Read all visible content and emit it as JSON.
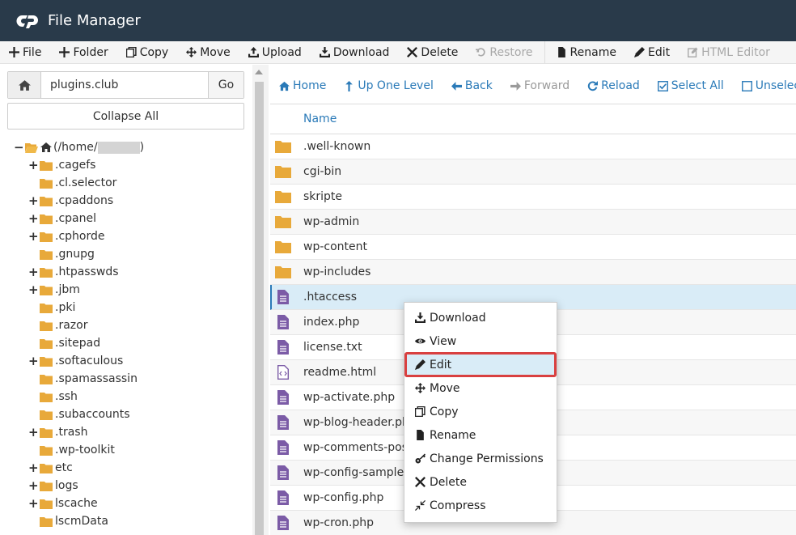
{
  "app": {
    "title": "File Manager"
  },
  "toolbar": {
    "file": "File",
    "folder": "Folder",
    "copy": "Copy",
    "move": "Move",
    "upload": "Upload",
    "download": "Download",
    "delete": "Delete",
    "restore": "Restore",
    "rename": "Rename",
    "edit": "Edit",
    "html_editor": "HTML Editor"
  },
  "path": {
    "value": "plugins.club",
    "go": "Go"
  },
  "collapse_all": "Collapse All",
  "tree": {
    "root_prefix": "(/home/",
    "root_suffix": ")",
    "items": [
      {
        "label": ".cagefs",
        "expandable": true
      },
      {
        "label": ".cl.selector",
        "expandable": false
      },
      {
        "label": ".cpaddons",
        "expandable": true
      },
      {
        "label": ".cpanel",
        "expandable": true
      },
      {
        "label": ".cphorde",
        "expandable": true
      },
      {
        "label": ".gnupg",
        "expandable": false
      },
      {
        "label": ".htpasswds",
        "expandable": true
      },
      {
        "label": ".jbm",
        "expandable": true
      },
      {
        "label": ".pki",
        "expandable": false
      },
      {
        "label": ".razor",
        "expandable": false
      },
      {
        "label": ".sitepad",
        "expandable": false
      },
      {
        "label": ".softaculous",
        "expandable": true
      },
      {
        "label": ".spamassassin",
        "expandable": false
      },
      {
        "label": ".ssh",
        "expandable": false
      },
      {
        "label": ".subaccounts",
        "expandable": false
      },
      {
        "label": ".trash",
        "expandable": true
      },
      {
        "label": ".wp-toolkit",
        "expandable": false
      },
      {
        "label": "etc",
        "expandable": true
      },
      {
        "label": "logs",
        "expandable": true
      },
      {
        "label": "lscache",
        "expandable": true
      },
      {
        "label": "lscmData",
        "expandable": false
      }
    ]
  },
  "nav": {
    "home": "Home",
    "up": "Up One Level",
    "back": "Back",
    "forward": "Forward",
    "reload": "Reload",
    "select_all": "Select All",
    "unselect": "Unselect All"
  },
  "table": {
    "header_name": "Name",
    "rows": [
      {
        "name": ".well-known",
        "type": "folder"
      },
      {
        "name": "cgi-bin",
        "type": "folder"
      },
      {
        "name": "skripte",
        "type": "folder"
      },
      {
        "name": "wp-admin",
        "type": "folder"
      },
      {
        "name": "wp-content",
        "type": "folder"
      },
      {
        "name": "wp-includes",
        "type": "folder"
      },
      {
        "name": ".htaccess",
        "type": "file",
        "selected": true
      },
      {
        "name": "index.php",
        "type": "file"
      },
      {
        "name": "license.txt",
        "type": "file"
      },
      {
        "name": "readme.html",
        "type": "html"
      },
      {
        "name": "wp-activate.php",
        "type": "file"
      },
      {
        "name": "wp-blog-header.php",
        "type": "file"
      },
      {
        "name": "wp-comments-post.php",
        "type": "file"
      },
      {
        "name": "wp-config-sample.php",
        "type": "file"
      },
      {
        "name": "wp-config.php",
        "type": "file"
      },
      {
        "name": "wp-cron.php",
        "type": "file"
      }
    ]
  },
  "context_menu": {
    "items": [
      {
        "label": "Download",
        "icon": "download-icon"
      },
      {
        "label": "View",
        "icon": "eye-icon"
      },
      {
        "label": "Edit",
        "icon": "pencil-icon",
        "active": true
      },
      {
        "label": "Move",
        "icon": "move-icon"
      },
      {
        "label": "Copy",
        "icon": "copy-icon"
      },
      {
        "label": "Rename",
        "icon": "file-icon"
      },
      {
        "label": "Change Permissions",
        "icon": "key-icon"
      },
      {
        "label": "Delete",
        "icon": "close-icon"
      },
      {
        "label": "Compress",
        "icon": "compress-icon"
      }
    ]
  },
  "colors": {
    "header_bg": "#293a4a",
    "link_blue": "#2a7ab8",
    "folder": "#e8a93a",
    "file_icon": "#7b5ba6",
    "selected_row": "#d9ecf7",
    "highlight_red": "#d94040"
  }
}
